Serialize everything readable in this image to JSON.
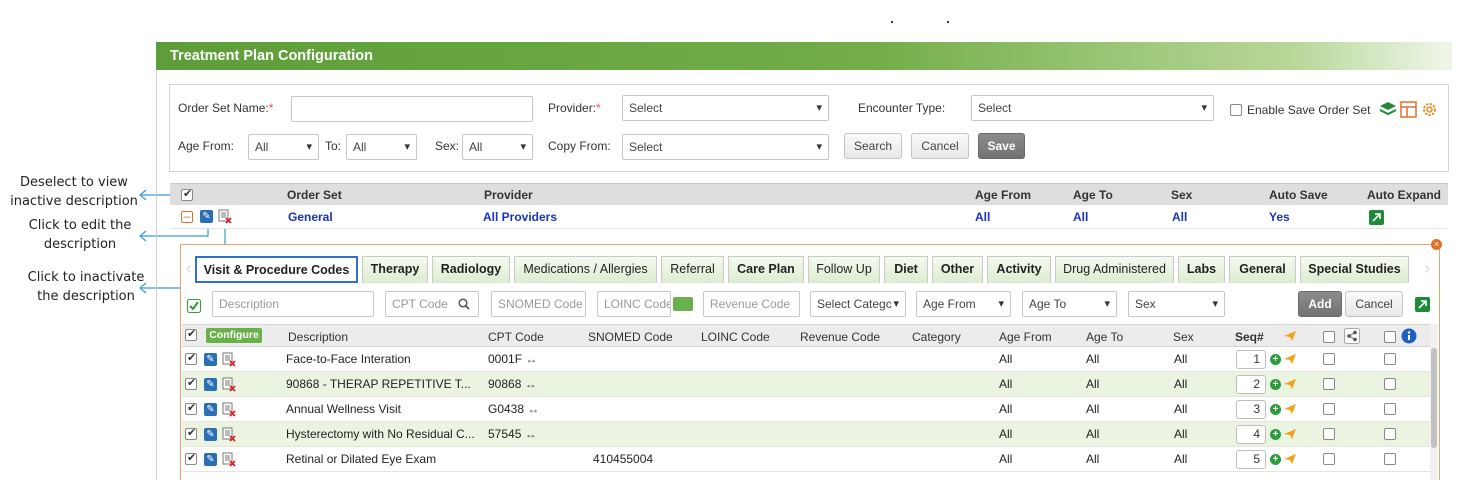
{
  "annotations": {
    "deselect": "Deselect to view inactive description",
    "edit": "Click to edit the description",
    "inactivate": "Click to inactivate the description"
  },
  "header": {
    "title": "Treatment Plan Configuration"
  },
  "form": {
    "order_set_name_label": "Order Set Name:",
    "order_set_name_value": "",
    "provider_label": "Provider:",
    "provider_value": "Select",
    "encounter_type_label": "Encounter Type:",
    "encounter_type_value": "Select",
    "enable_save_label": "Enable Save Order Set",
    "age_from_label": "Age From:",
    "age_from_value": "All",
    "to_label": "To:",
    "to_value": "All",
    "sex_label": "Sex:",
    "sex_value": "All",
    "copy_from_label": "Copy From:",
    "copy_from_value": "Select",
    "search_label": "Search",
    "cancel_label": "Cancel",
    "save_label": "Save",
    "required_mark": "*"
  },
  "order_set_table": {
    "headers": {
      "order_set": "Order Set",
      "provider": "Provider",
      "age_from": "Age From",
      "age_to": "Age To",
      "sex": "Sex",
      "auto_save": "Auto Save",
      "auto_expand": "Auto Expand"
    },
    "row": {
      "order_set": "General",
      "provider": "All Providers",
      "age_from": "All",
      "age_to": "All",
      "sex": "All",
      "auto_save": "Yes"
    }
  },
  "tabs": [
    {
      "label": "Visit & Procedure Codes"
    },
    {
      "label": "Therapy"
    },
    {
      "label": "Radiology"
    },
    {
      "label": "Medications / Allergies"
    },
    {
      "label": "Referral"
    },
    {
      "label": "Care Plan"
    },
    {
      "label": "Follow Up"
    },
    {
      "label": "Diet"
    },
    {
      "label": "Other"
    },
    {
      "label": "Activity"
    },
    {
      "label": "Drug Administered"
    },
    {
      "label": "Labs"
    },
    {
      "label": "General"
    },
    {
      "label": "Special Studies"
    }
  ],
  "filters": {
    "description_placeholder": "Description",
    "cpt_placeholder": "CPT Code",
    "snomed_placeholder": "SNOMED Code",
    "loinc_placeholder": "LOINC Code",
    "revenue_placeholder": "Revenue Code",
    "category_value": "Select Categc",
    "age_from_value": "Age From",
    "age_to_value": "Age To",
    "sex_value": "Sex",
    "add_label": "Add",
    "cancel_label": "Cancel"
  },
  "grid": {
    "configure_label": "Configure",
    "headers": {
      "description": "Description",
      "cpt": "CPT Code",
      "snomed": "SNOMED Code",
      "loinc": "LOINC Code",
      "revenue": "Revenue Code",
      "category": "Category",
      "age_from": "Age From",
      "age_to": "Age To",
      "sex": "Sex",
      "seq": "Seq#"
    },
    "rows": [
      {
        "description": "Face-to-Face Interation",
        "cpt": "0001F",
        "snomed": "",
        "age_from": "All",
        "age_to": "All",
        "sex": "All",
        "seq": "1"
      },
      {
        "description": "90868 - THERAP REPETITIVE T...",
        "cpt": "90868",
        "snomed": "",
        "age_from": "All",
        "age_to": "All",
        "sex": "All",
        "seq": "2"
      },
      {
        "description": "Annual Wellness Visit",
        "cpt": "G0438",
        "snomed": "",
        "age_from": "All",
        "age_to": "All",
        "sex": "All",
        "seq": "3"
      },
      {
        "description": "Hysterectomy with No Residual C...",
        "cpt": "57545",
        "snomed": "",
        "age_from": "All",
        "age_to": "All",
        "sex": "All",
        "seq": "4"
      },
      {
        "description": "Retinal or Dilated Eye Exam",
        "cpt": "",
        "snomed": "410455004",
        "age_from": "All",
        "age_to": "All",
        "sex": "All",
        "seq": "5"
      }
    ]
  },
  "colors": {
    "header_green": "#5d9e3a",
    "link_blue": "#1a34b8",
    "tab_active_border": "#2f6fd6",
    "row_alt": "#eaf4e0",
    "accent_orange": "#e0702b"
  }
}
